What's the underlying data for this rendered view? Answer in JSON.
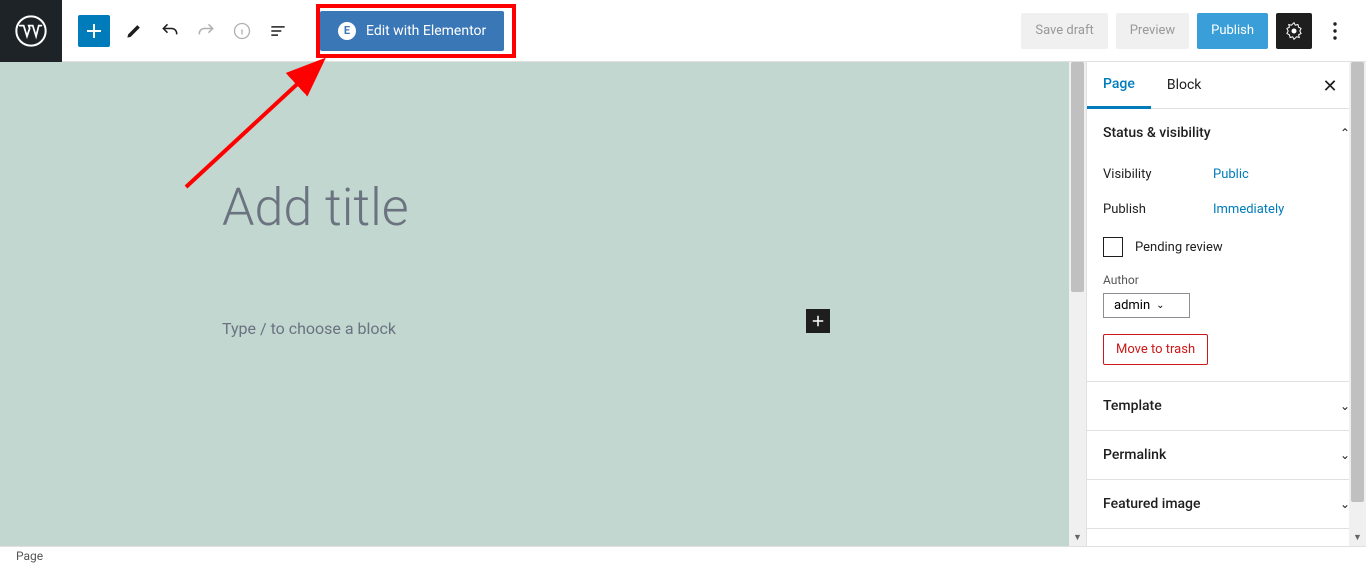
{
  "toolbar": {
    "elementor_label": "Edit with Elementor",
    "save_draft": "Save draft",
    "preview": "Preview",
    "publish": "Publish"
  },
  "canvas": {
    "title_placeholder": "Add title",
    "block_placeholder": "Type / to choose a block"
  },
  "sidebar": {
    "tabs": {
      "page": "Page",
      "block": "Block"
    },
    "status": {
      "title": "Status & visibility",
      "visibility_label": "Visibility",
      "visibility_value": "Public",
      "publish_label": "Publish",
      "publish_value": "Immediately",
      "pending_review": "Pending review",
      "author_label": "Author",
      "author_value": "admin",
      "trash": "Move to trash"
    },
    "panels": {
      "template": "Template",
      "permalink": "Permalink",
      "featured": "Featured image"
    }
  },
  "footer": {
    "breadcrumb": "Page"
  }
}
